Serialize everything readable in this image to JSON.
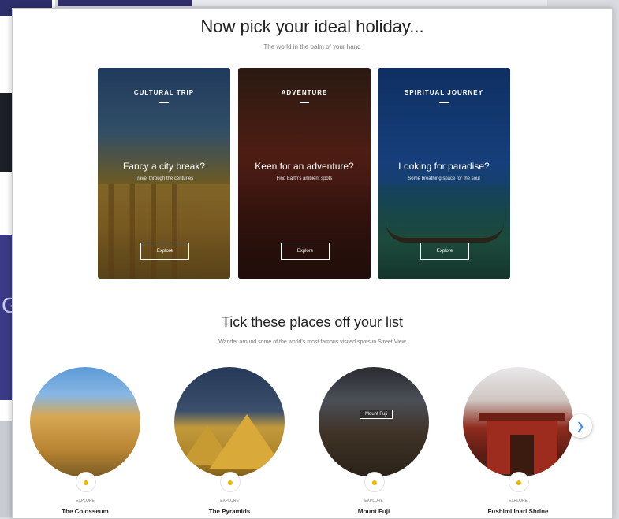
{
  "header": {
    "title": "Now pick your ideal holiday...",
    "subtitle": "The world in the palm of your hand"
  },
  "cards": [
    {
      "label": "CULTURAL TRIP",
      "headline": "Fancy a city break?",
      "desc": "Travel through the centuries",
      "button": "Explore"
    },
    {
      "label": "ADVENTURE",
      "headline": "Keen for an adventure?",
      "desc": "Find Earth's ambient spots",
      "button": "Explore"
    },
    {
      "label": "SPIRITUAL JOURNEY",
      "headline": "Looking for paradise?",
      "desc": "Some breathing space for the soul",
      "button": "Explore"
    }
  ],
  "section2": {
    "title": "Tick these places off your list",
    "subtitle": "Wander around some of the world's most famous visited spots in Street View"
  },
  "places": [
    {
      "explore": "EXPLORE",
      "name": "The Colosseum"
    },
    {
      "explore": "EXPLORE",
      "name": "The Pyramids"
    },
    {
      "explore": "EXPLORE",
      "name": "Mount Fuji",
      "sign": "Mount Fuji"
    },
    {
      "explore": "EXPLORE",
      "name": "Fushimi Inari Shrine"
    }
  ],
  "icons": {
    "pegman": "pegman-icon",
    "next": "chevron-right-icon"
  },
  "background": {
    "glyph": "G"
  }
}
